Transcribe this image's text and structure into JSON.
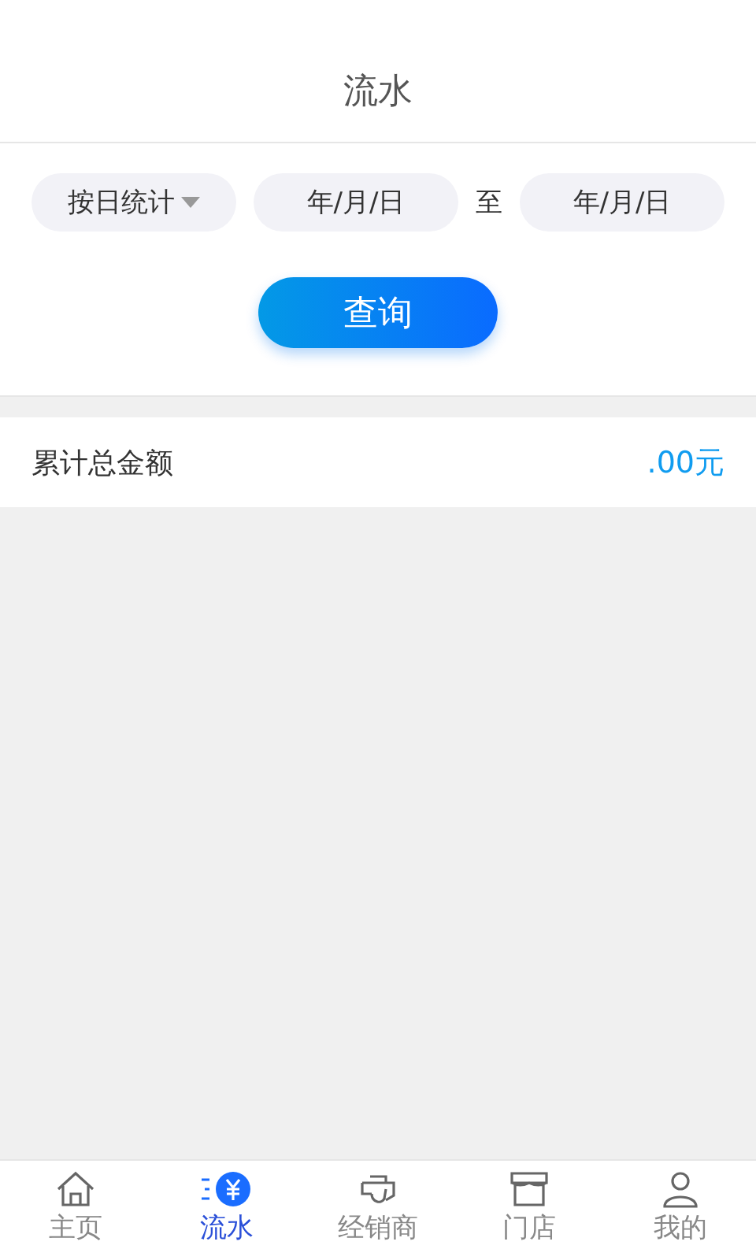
{
  "header": {
    "title": "流水"
  },
  "filters": {
    "mode": "按日统计",
    "start_date": "年/月/日",
    "separator": "至",
    "end_date": "年/月/日"
  },
  "query_button": "查询",
  "total": {
    "label": "累计总金额",
    "value": ".00元"
  },
  "tabs": [
    {
      "kind": "home",
      "label": "主页",
      "selected": false
    },
    {
      "kind": "flow",
      "label": "流水",
      "selected": true
    },
    {
      "kind": "dealer",
      "label": "经销商",
      "selected": false
    },
    {
      "kind": "store",
      "label": "门店",
      "selected": false
    },
    {
      "kind": "profile",
      "label": "我的",
      "selected": false
    }
  ]
}
